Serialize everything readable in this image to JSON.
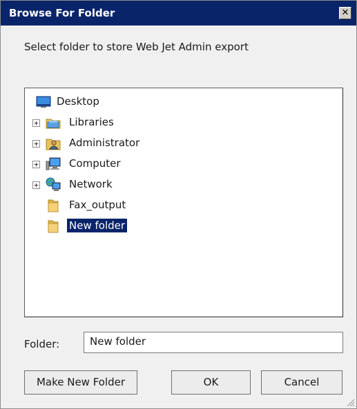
{
  "window": {
    "title": "Browse For Folder",
    "close_label": "✕"
  },
  "instruction": "Select folder to store Web Jet Admin export",
  "tree": {
    "items": [
      {
        "label": "Desktop",
        "icon": "desktop-icon",
        "expandable": false
      },
      {
        "label": "Libraries",
        "icon": "libraries-icon",
        "expandable": true
      },
      {
        "label": "Administrator",
        "icon": "user-folder-icon",
        "expandable": true
      },
      {
        "label": "Computer",
        "icon": "computer-icon",
        "expandable": true
      },
      {
        "label": "Network",
        "icon": "network-icon",
        "expandable": true
      },
      {
        "label": "Fax_output",
        "icon": "folder-icon",
        "expandable": false
      },
      {
        "label": "New folder",
        "icon": "folder-icon",
        "expandable": false,
        "selected": true
      }
    ]
  },
  "folder": {
    "label": "Folder:",
    "value": "New folder"
  },
  "buttons": {
    "make_new_folder": "Make New Folder",
    "ok": "OK",
    "cancel": "Cancel"
  },
  "colors": {
    "titlebar": "#0a246a",
    "selection": "#0a246a",
    "dialog_bg": "#f0f0f0"
  }
}
